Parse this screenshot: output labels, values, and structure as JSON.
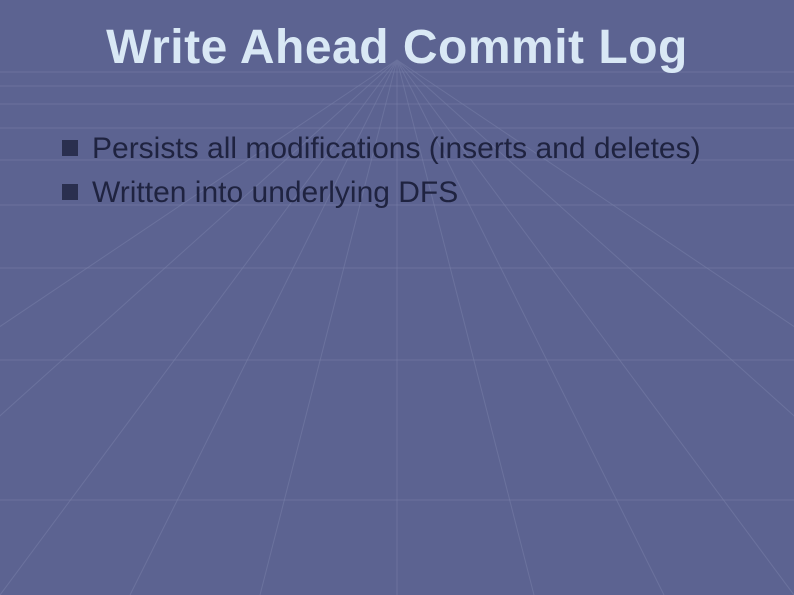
{
  "title": "Write Ahead Commit Log",
  "bullets": [
    "Persists all modifications (inserts and deletes)",
    "Written into underlying DFS"
  ],
  "colors": {
    "background": "#5c6391",
    "title": "#d9e8f5",
    "body": "#1f2340",
    "bullet": "#2a2f4f",
    "grid": "#7a81aa"
  }
}
